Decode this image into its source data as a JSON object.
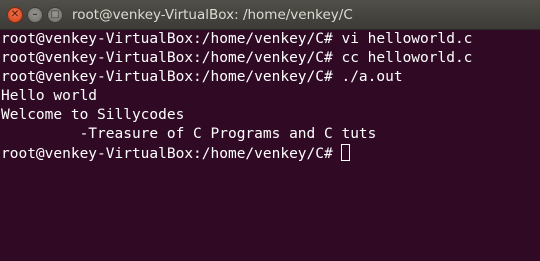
{
  "window": {
    "title": "root@venkey-VirtualBox: /home/venkey/C",
    "buttons": {
      "close": "✕",
      "minimize": "–",
      "maximize": "□"
    }
  },
  "terminal": {
    "lines": [
      "root@venkey-VirtualBox:/home/venkey/C# vi helloworld.c",
      "root@venkey-VirtualBox:/home/venkey/C# cc helloworld.c",
      "root@venkey-VirtualBox:/home/venkey/C# ./a.out",
      "Hello world",
      "Welcome to Sillycodes",
      "         -Treasure of C Programs and C tuts"
    ],
    "prompt": "root@venkey-VirtualBox:/home/venkey/C# "
  },
  "colors": {
    "terminal_background": "#300a24",
    "text": "#ffffff",
    "titlebar": "#3c3b37",
    "close_button": "#e2542c"
  }
}
